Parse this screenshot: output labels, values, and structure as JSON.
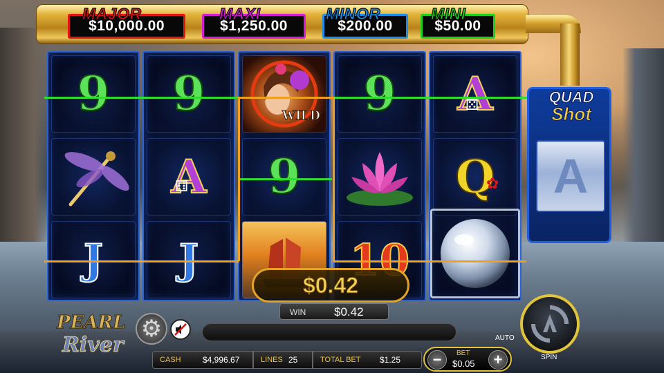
{
  "jackpots": {
    "major": {
      "title": "MAJOR",
      "value": "$10,000.00",
      "color": "#e01616"
    },
    "maxi": {
      "title": "MAXI",
      "value": "$1,250.00",
      "color": "#d31ed6"
    },
    "minor": {
      "title": "MINOR",
      "value": "$200.00",
      "color": "#1b8fe8"
    },
    "mini": {
      "title": "MINI",
      "value": "$50.00",
      "color": "#1fcf1f"
    }
  },
  "reels": [
    {
      "symbols": [
        "9",
        "dragonfly",
        "J"
      ]
    },
    {
      "symbols": [
        "9",
        "A",
        "J"
      ]
    },
    {
      "symbols": [
        "geisha-wild",
        "9",
        "junk-boat"
      ]
    },
    {
      "symbols": [
        "9",
        "lotus",
        "10"
      ]
    },
    {
      "symbols": [
        "A",
        "Q",
        "pearl"
      ]
    }
  ],
  "symbol_labels": {
    "nine": "9",
    "ace": "A",
    "jack": "J",
    "queen": "Q",
    "ten": "10",
    "wild": "WILD"
  },
  "quad_shot": {
    "title_line1": "QUAD",
    "title_line2": "Shot",
    "reel_symbol": "A"
  },
  "win": {
    "amount": "$0.42",
    "label": "WIN",
    "value": "$0.42"
  },
  "logo": {
    "line1": "PEARL",
    "line2": "River"
  },
  "stats": {
    "cash_label": "CASH",
    "cash_value": "$4,996.67",
    "lines_label": "LINES",
    "lines_value": "25",
    "total_bet_label": "TOTAL BET",
    "total_bet_value": "$1.25"
  },
  "bet": {
    "label": "BET",
    "value": "$0.05",
    "minus": "−",
    "plus": "+"
  },
  "controls": {
    "auto_label": "AUTO",
    "spin_label": "SPIN"
  },
  "icons": {
    "settings": "gear-icon",
    "sound": "sound-muted-icon",
    "spin": "spin-icon"
  },
  "colors": {
    "payline_green": "#2fdc2f",
    "payline_orange": "#f0a020",
    "reel_border": "#2b62d6",
    "gold": "#e2a325"
  }
}
